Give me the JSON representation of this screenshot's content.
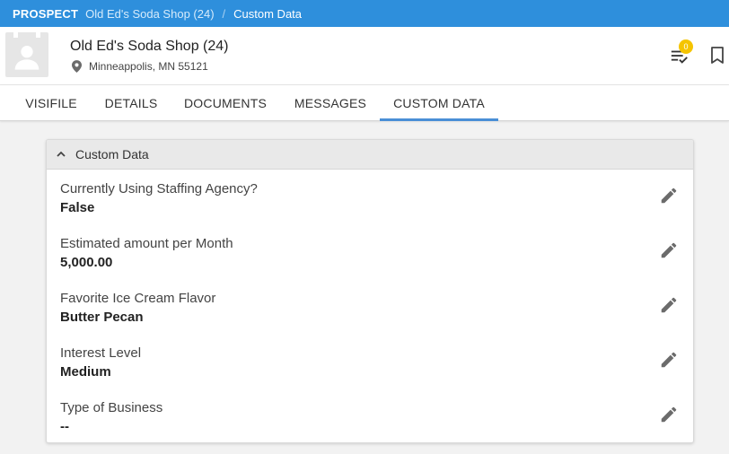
{
  "breadcrumb": {
    "module": "PROSPECT",
    "record_link": "Old Ed's Soda Shop (24)",
    "separator": "/",
    "current": "Custom Data"
  },
  "header": {
    "record_name": "Old Ed's Soda Shop (24)",
    "location": "Minneappolis, MN 55121",
    "tasks_badge": "0"
  },
  "tabs": [
    {
      "label": "VISIFILE"
    },
    {
      "label": "DETAILS"
    },
    {
      "label": "DOCUMENTS"
    },
    {
      "label": "MESSAGES"
    },
    {
      "label": "CUSTOM DATA",
      "active": true
    }
  ],
  "panel": {
    "title": "Custom Data",
    "fields": [
      {
        "label": "Currently Using Staffing Agency?",
        "value": "False"
      },
      {
        "label": "Estimated amount per Month",
        "value": "5,000.00"
      },
      {
        "label": "Favorite Ice Cream Flavor",
        "value": "Butter Pecan"
      },
      {
        "label": "Interest Level",
        "value": "Medium"
      },
      {
        "label": "Type of Business",
        "value": "--"
      }
    ]
  },
  "colors": {
    "topbar": "#2e8fdc",
    "active_tab_underline": "#4a8fd6",
    "badge": "#f5c400",
    "icon_gray": "#6b6b6b"
  },
  "icons": {
    "avatar": "person-silhouette-icon",
    "location": "map-pin-icon",
    "tasks": "checklist-icon",
    "bookmark": "bookmark-icon",
    "collapse": "chevron-up-icon",
    "edit": "pencil-icon"
  }
}
